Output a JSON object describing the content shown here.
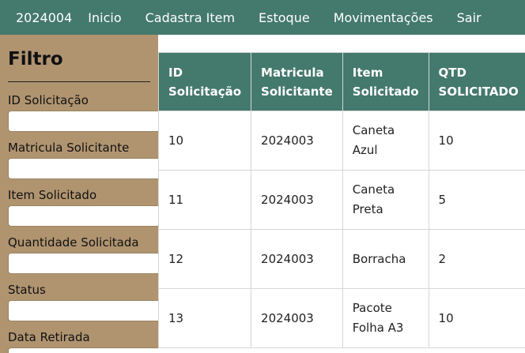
{
  "nav": {
    "user_id": "2024004",
    "items": [
      "Inicio",
      "Cadastra Item",
      "Estoque",
      "Movimentações",
      "Sair"
    ]
  },
  "sidebar": {
    "title": "Filtro",
    "fields": [
      {
        "label": "ID Solicitação",
        "value": ""
      },
      {
        "label": "Matricula Solicitante",
        "value": ""
      },
      {
        "label": "Item Solicitado",
        "value": ""
      },
      {
        "label": "Quantidade Solicitada",
        "value": ""
      },
      {
        "label": "Status",
        "value": ""
      },
      {
        "label": "Data Retirada",
        "value": ""
      }
    ]
  },
  "table": {
    "headers": [
      "ID Solicitação",
      "Matricula Solicitante",
      "Item Solicitado",
      "QTD SOLICITADO"
    ],
    "rows": [
      [
        "10",
        "2024003",
        "Caneta Azul",
        "10"
      ],
      [
        "11",
        "2024003",
        "Caneta Preta",
        "5"
      ],
      [
        "12",
        "2024003",
        "Borracha",
        "2"
      ],
      [
        "13",
        "2024003",
        "Pacote Folha A3",
        "10"
      ]
    ]
  },
  "colors": {
    "header_bg": "#44796d",
    "sidebar_bg": "#b09470"
  }
}
